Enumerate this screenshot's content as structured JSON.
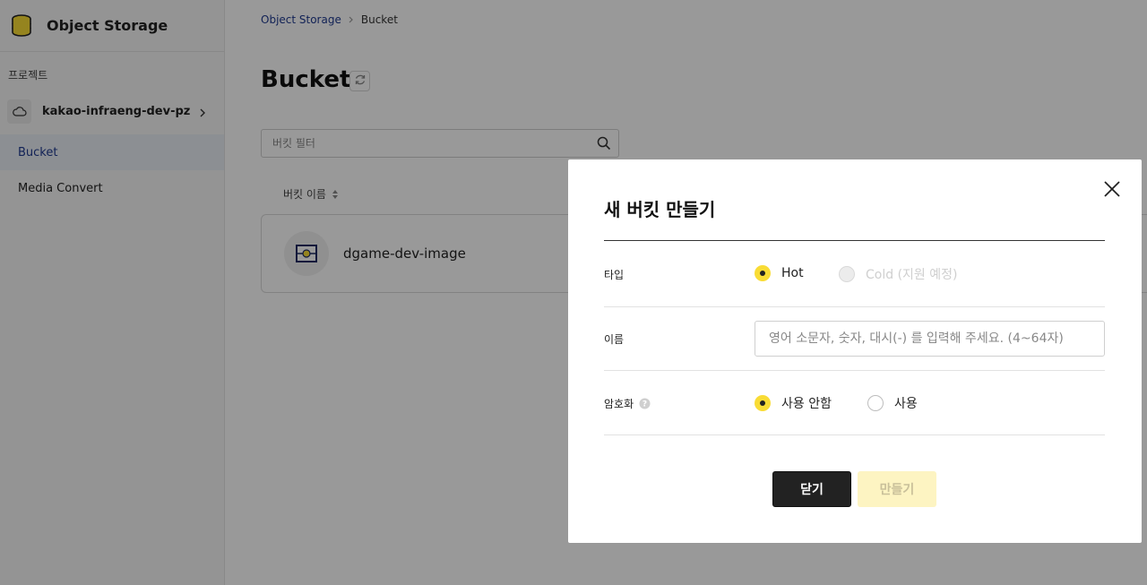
{
  "sidebar": {
    "app_title": "Object Storage",
    "section_label": "프로젝트",
    "project_name": "kakao-infraeng-dev-pz",
    "items": [
      {
        "label": "Bucket",
        "active": true
      },
      {
        "label": "Media Convert",
        "active": false
      }
    ]
  },
  "main": {
    "breadcrumb": {
      "root": "Object Storage",
      "current": "Bucket"
    },
    "page_title": "Bucket",
    "filter_placeholder": "버킷 필터",
    "column_header": "버킷 이름",
    "buckets": [
      {
        "name": "dgame-dev-image"
      }
    ]
  },
  "modal": {
    "title": "새 버킷 만들기",
    "type_label": "타입",
    "type_options": [
      {
        "label": "Hot",
        "state": "checked"
      },
      {
        "label": "Cold (지원 예정)",
        "state": "disabled"
      }
    ],
    "name_label": "이름",
    "name_placeholder": "영어 소문자, 숫자, 대시(-) 를 입력해 주세요. (4~64자)",
    "encryption_label": "암호화",
    "encryption_options": [
      {
        "label": "사용 안함",
        "state": "checked"
      },
      {
        "label": "사용",
        "state": "unchecked"
      }
    ],
    "close_button": "닫기",
    "create_button": "만들기"
  },
  "colors": {
    "accent_yellow": "#f9dc35",
    "active_nav_text": "#1f3a8f",
    "overlay": "rgba(0,0,0,0.4)"
  }
}
